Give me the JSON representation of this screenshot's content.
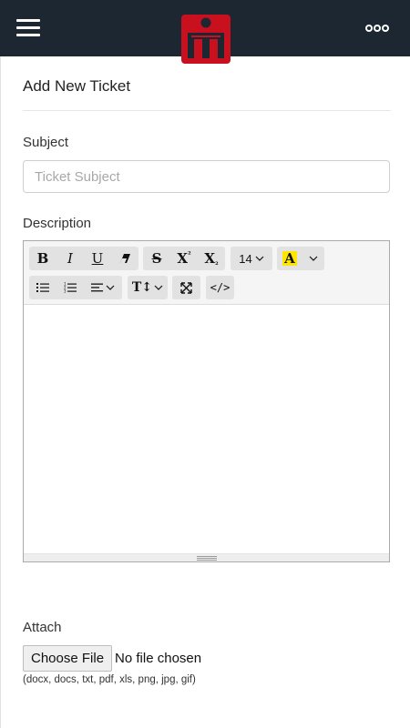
{
  "page": {
    "title": "Add New Ticket"
  },
  "colors": {
    "topbar": "#1d2731",
    "logo": "#c8101e",
    "highlight": "#ffe600"
  },
  "header": {
    "menu_icon": "hamburger-menu-icon",
    "logo_icon": "m-logo-icon",
    "more_icon": "more-options-icon"
  },
  "subject": {
    "label": "Subject",
    "placeholder": "Ticket Subject",
    "value": ""
  },
  "description": {
    "label": "Description",
    "toolbar": {
      "bold": "B",
      "italic": "I",
      "underline": "U",
      "eraser_icon": "eraser-icon",
      "strikethrough": "S",
      "superscript_main": "X",
      "superscript_small": "²",
      "subscript_main": "X",
      "subscript_small": "₂",
      "font_size": "14",
      "color_letter": "A",
      "unordered_list_icon": "unordered-list-icon",
      "ordered_list_icon": "ordered-list-icon",
      "align_icon": "align-left-icon",
      "line_height_label": "T↕",
      "fullscreen_icon": "fullscreen-icon",
      "code_view": "</>"
    }
  },
  "attach": {
    "label": "Attach",
    "button_label": "Choose File",
    "status": "No file chosen",
    "allowed_types": "(docx, docs, txt, pdf, xls, png, jpg, gif)"
  }
}
